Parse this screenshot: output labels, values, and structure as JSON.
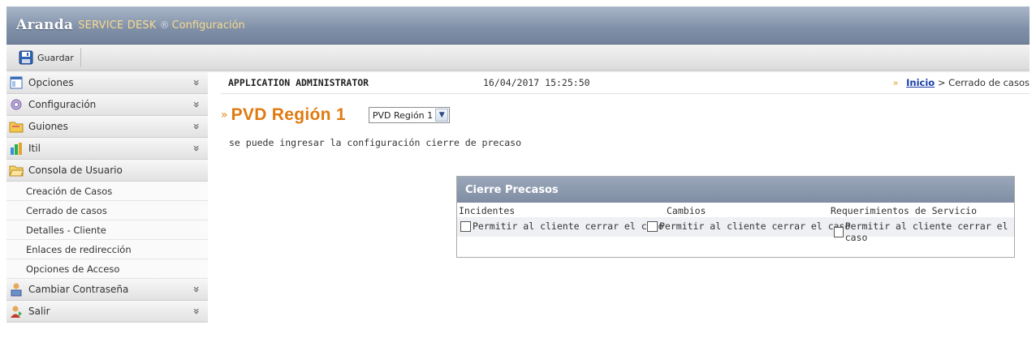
{
  "header": {
    "brand": "Aranda",
    "product": "SERVICE DESK",
    "reg_mark": "®",
    "module": "Configuración"
  },
  "toolbar": {
    "save_label": "Guardar"
  },
  "sidebar": {
    "sections": [
      {
        "label": "Opciones",
        "icon": "window-icon"
      },
      {
        "label": "Configuración",
        "icon": "gear-icon"
      },
      {
        "label": "Guiones",
        "icon": "folder-icon"
      },
      {
        "label": "Itil",
        "icon": "bar-chart-icon"
      },
      {
        "label": "Consola de Usuario",
        "icon": "folder-open-icon"
      }
    ],
    "subitems": [
      "Creación de Casos",
      "Cerrado de casos",
      "Detalles - Cliente",
      "Enlaces de redirección",
      "Opciones de Acceso"
    ],
    "bottom_sections": [
      {
        "label": "Cambiar Contraseña",
        "icon": "key-user-icon"
      },
      {
        "label": "Salir",
        "icon": "exit-user-icon"
      }
    ],
    "chevron": "»"
  },
  "main": {
    "user": "APPLICATION ADMINISTRATOR",
    "datetime": "16/04/2017 15:25:50",
    "breadcrumb": {
      "arrow": "»",
      "home": "Inicio",
      "separator": ">",
      "current": "Cerrado de casos"
    },
    "title": "PVD Región 1",
    "title_arrow": "»",
    "select_value": "PVD Región 1",
    "description": "se puede ingresar la configuración cierre de precaso"
  },
  "panel": {
    "title": "Cierre Precasos",
    "columns": [
      "Incidentes",
      "Cambios",
      "Requerimientos de Servicio"
    ],
    "checkbox_label": "Permitir al cliente cerrar el caso",
    "checked": [
      false,
      false,
      false
    ]
  },
  "colors": {
    "header_bg": "#7f8fa7",
    "accent_orange": "#e07a10",
    "link_blue": "#1a3ea8"
  }
}
